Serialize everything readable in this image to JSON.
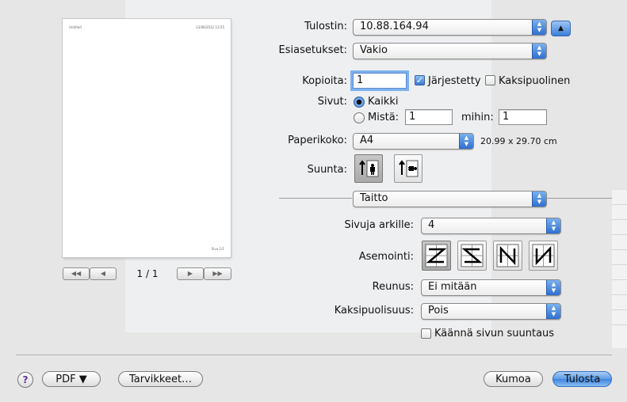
{
  "preview": {
    "header_left": "Untitled",
    "header_right": "13/06/2012 13:55",
    "footer": "Sivu 1/1",
    "pager": "1 / 1",
    "nav_first": "◀◀",
    "nav_prev": "◀",
    "nav_next": "▶",
    "nav_last": "▶▶"
  },
  "printer": {
    "label": "Tulostin:",
    "value": "10.88.164.94"
  },
  "presets": {
    "label": "Esiasetukset:",
    "value": "Vakio"
  },
  "copies": {
    "label": "Kopioita:",
    "value": "1",
    "collated_label": "Järjestetty",
    "collated": true,
    "duplex_label": "Kaksipuolinen",
    "duplex": false
  },
  "pages": {
    "label": "Sivut:",
    "all_label": "Kaikki",
    "from_label": "Mistä:",
    "from_value": "1",
    "to_label": "mihin:",
    "to_value": "1",
    "selected": "all"
  },
  "paper": {
    "label": "Paperikoko:",
    "value": "A4",
    "dimensions": "20.99 x 29.70 cm"
  },
  "orientation": {
    "label": "Suunta:"
  },
  "section": {
    "value": "Taitto"
  },
  "layout": {
    "pages_per_sheet_label": "Sivuja arkille:",
    "pages_per_sheet": "4",
    "direction_label": "Asemointi:",
    "border_label": "Reunus:",
    "border": "Ei mitään",
    "two_sided_label": "Kaksipuolisuus:",
    "two_sided": "Pois",
    "reverse_label": "Käännä sivun suuntaus",
    "reverse": false
  },
  "footer": {
    "help": "?",
    "pdf": "PDF ▼",
    "supplies": "Tarvikkeet…",
    "cancel": "Kumoa",
    "print": "Tulosta"
  },
  "colors": {
    "accent": "#3f84de",
    "selected_icon_bg": "#b5b5b5"
  }
}
